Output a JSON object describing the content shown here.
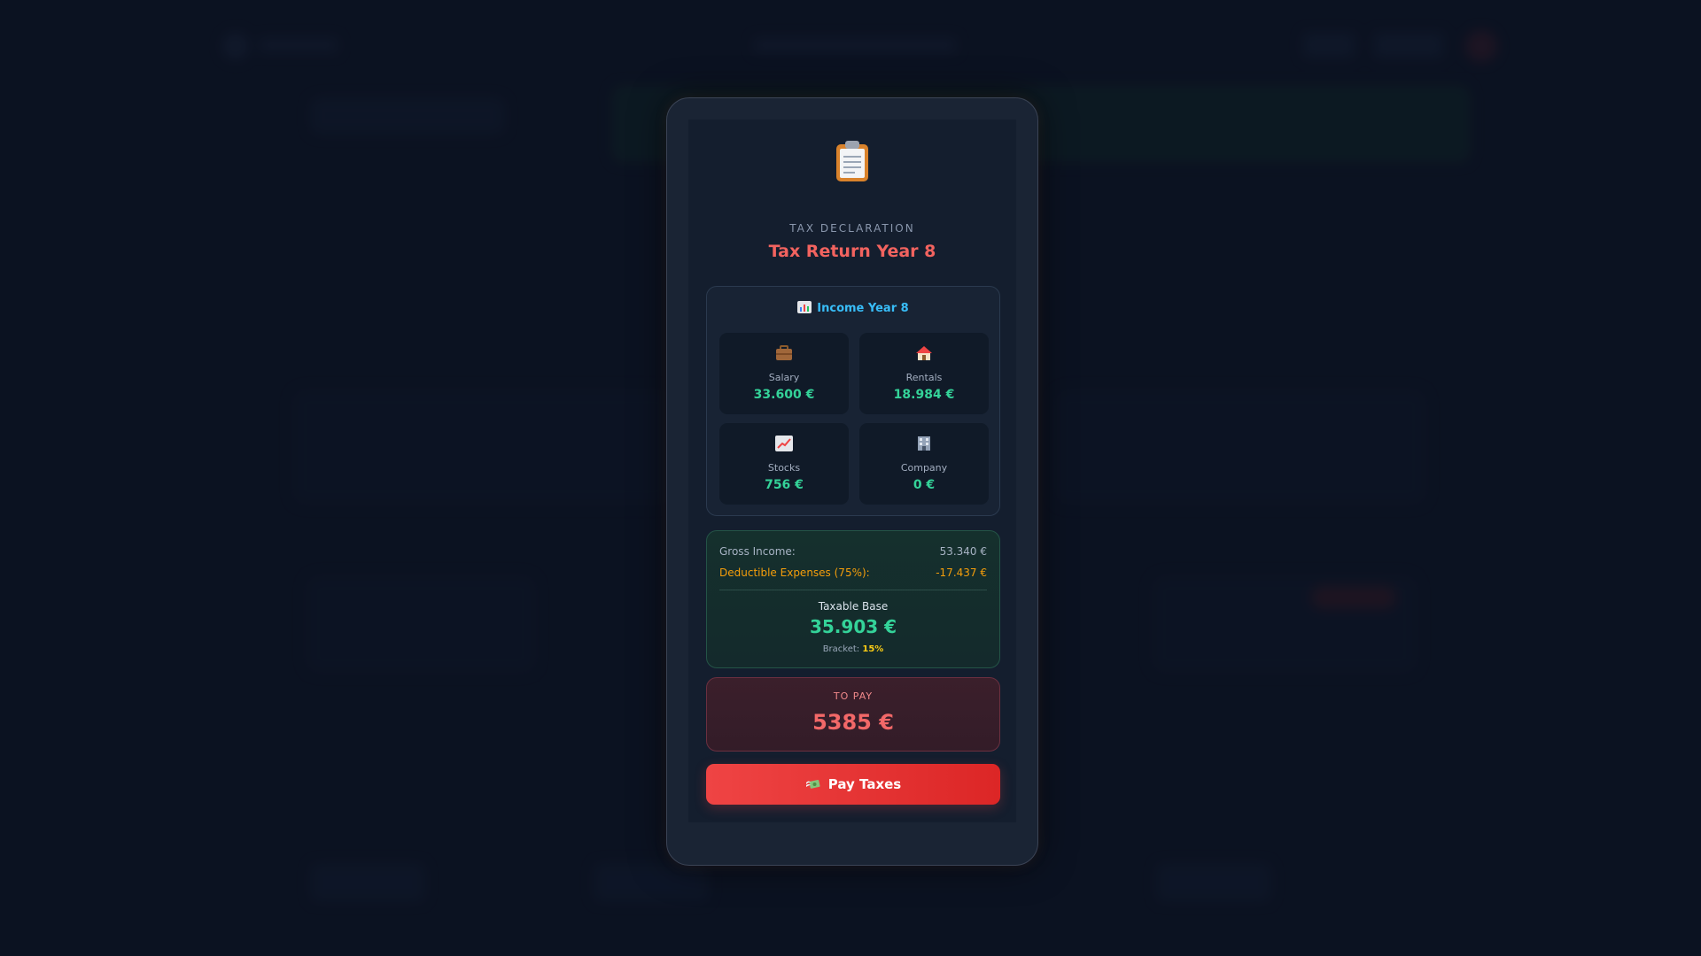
{
  "modal": {
    "header_label": "TAX DECLARATION",
    "title": "Tax Return Year 8",
    "header_icon": "clipboard-icon"
  },
  "income": {
    "heading": "Income Year 8",
    "heading_icon": "bar-chart-icon",
    "items": [
      {
        "label": "Salary",
        "value": "33.600 €",
        "icon": "briefcase-icon"
      },
      {
        "label": "Rentals",
        "value": "18.984 €",
        "icon": "house-icon"
      },
      {
        "label": "Stocks",
        "value": "756 €",
        "icon": "trending-up-icon"
      },
      {
        "label": "Company",
        "value": "0 €",
        "icon": "office-building-icon"
      }
    ]
  },
  "summary": {
    "gross_label": "Gross Income:",
    "gross_value": "53.340 €",
    "deduct_label": "Deductible Expenses (75%):",
    "deduct_value": "-17.437 €",
    "taxable_label": "Taxable Base",
    "taxable_value": "35.903 €",
    "bracket_label": "Bracket:",
    "bracket_value": "15%"
  },
  "payment": {
    "label": "TO PAY",
    "value": "5385 €",
    "button_label": "Pay Taxes",
    "button_icon": "money-with-wings-icon"
  },
  "colors": {
    "accent_red": "#f2635f",
    "income_blue": "#38bdf8",
    "value_green": "#34d399",
    "deduct_orange": "#f59e0b",
    "bracket_yellow": "#facc15"
  }
}
